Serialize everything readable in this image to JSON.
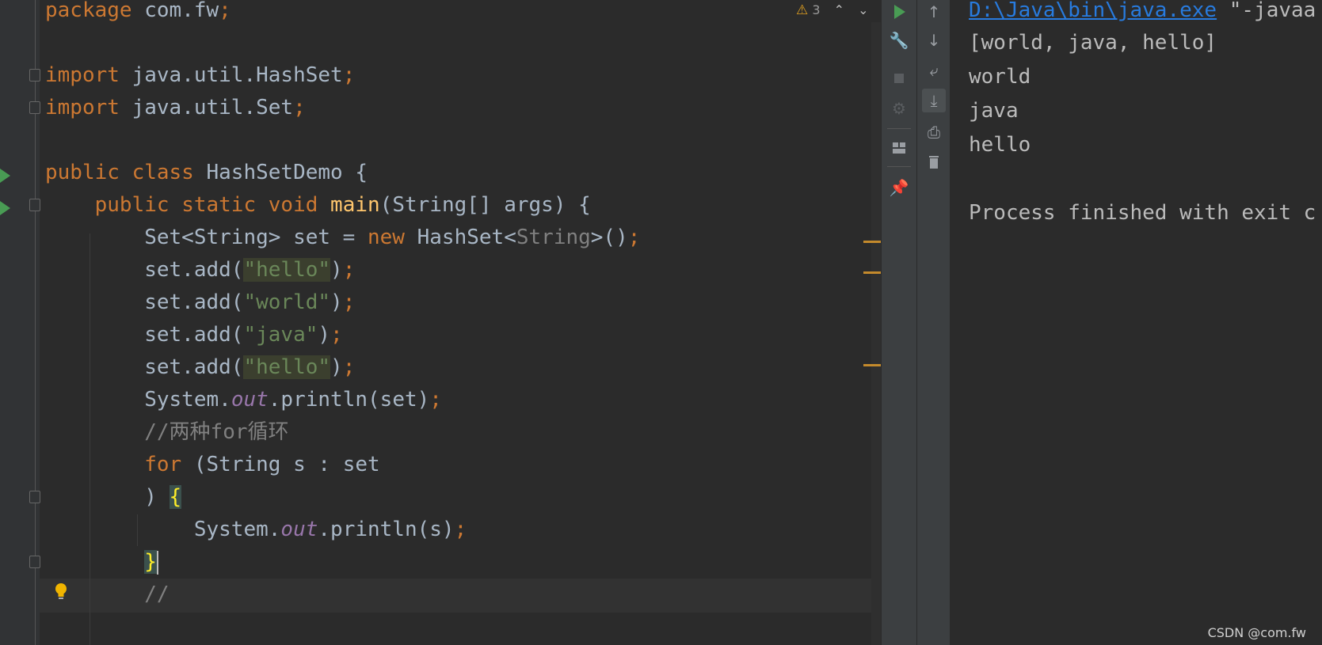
{
  "editor": {
    "lines": [
      {
        "tokens": [
          {
            "t": "package",
            "c": "kw"
          },
          {
            "t": " com.fw"
          },
          {
            "t": ";",
            "c": "kw"
          }
        ]
      },
      {
        "tokens": []
      },
      {
        "tokens": [
          {
            "t": "import",
            "c": "kw"
          },
          {
            "t": " java.util.HashSet"
          },
          {
            "t": ";",
            "c": "kw"
          }
        ]
      },
      {
        "tokens": [
          {
            "t": "import",
            "c": "kw"
          },
          {
            "t": " java.util.Set"
          },
          {
            "t": ";",
            "c": "kw"
          }
        ]
      },
      {
        "tokens": []
      },
      {
        "tokens": [
          {
            "t": "public class",
            "c": "kw"
          },
          {
            "t": " HashSetDemo {"
          }
        ]
      },
      {
        "tokens": [
          {
            "t": "    "
          },
          {
            "t": "public static void",
            "c": "kw"
          },
          {
            "t": " "
          },
          {
            "t": "main",
            "c": "fn"
          },
          {
            "t": "(String[] args) {"
          }
        ]
      },
      {
        "tokens": [
          {
            "t": "        Set<String> set = "
          },
          {
            "t": "new",
            "c": "kw"
          },
          {
            "t": " HashSet<"
          },
          {
            "t": "String",
            "c": "gen"
          },
          {
            "t": ">()"
          },
          {
            "t": ";",
            "c": "kw"
          }
        ]
      },
      {
        "tokens": [
          {
            "t": "        set.add("
          },
          {
            "t": "\"hello\"",
            "c": "str dup"
          },
          {
            "t": ")"
          },
          {
            "t": ";",
            "c": "kw"
          }
        ]
      },
      {
        "tokens": [
          {
            "t": "        set.add("
          },
          {
            "t": "\"world\"",
            "c": "str"
          },
          {
            "t": ")"
          },
          {
            "t": ";",
            "c": "kw"
          }
        ]
      },
      {
        "tokens": [
          {
            "t": "        set.add("
          },
          {
            "t": "\"java\"",
            "c": "str"
          },
          {
            "t": ")"
          },
          {
            "t": ";",
            "c": "kw"
          }
        ]
      },
      {
        "tokens": [
          {
            "t": "        set.add("
          },
          {
            "t": "\"hello\"",
            "c": "str dup"
          },
          {
            "t": ")"
          },
          {
            "t": ";",
            "c": "kw"
          }
        ]
      },
      {
        "tokens": [
          {
            "t": "        System."
          },
          {
            "t": "out",
            "c": "fld"
          },
          {
            "t": ".println(set)"
          },
          {
            "t": ";",
            "c": "kw"
          }
        ]
      },
      {
        "tokens": [
          {
            "t": "        "
          },
          {
            "t": "//两种for循环",
            "c": "cmt"
          }
        ]
      },
      {
        "tokens": [
          {
            "t": "        "
          },
          {
            "t": "for",
            "c": "kw"
          },
          {
            "t": " (String s : set"
          }
        ]
      },
      {
        "tokens": [
          {
            "t": "        ) "
          },
          {
            "t": "{",
            "c": "yel brace-hl"
          }
        ]
      },
      {
        "tokens": [
          {
            "t": "            System."
          },
          {
            "t": "out",
            "c": "fld"
          },
          {
            "t": ".println(s)"
          },
          {
            "t": ";",
            "c": "kw"
          }
        ]
      },
      {
        "tokens": [
          {
            "t": "        "
          },
          {
            "t": "}",
            "c": "yel brace-hl"
          },
          {
            "t": "",
            "c": "caret"
          }
        ]
      },
      {
        "tokens": [
          {
            "t": "        "
          },
          {
            "t": "//",
            "c": "cmt"
          }
        ]
      }
    ],
    "inspection": {
      "warning_count": "3"
    }
  },
  "console": {
    "command_link": "D:\\Java\\bin\\java.exe",
    "command_rest": " \"-javaa",
    "output": [
      "[world, java, hello]",
      "world",
      "java",
      "hello",
      "",
      "Process finished with exit c"
    ]
  },
  "watermark": "CSDN @com.fw",
  "colors": {
    "keyword": "#cc7832",
    "string": "#6a8759",
    "method": "#ffc66d",
    "field": "#9876aa",
    "comment": "#808080",
    "text": "#a9b7c6",
    "run": "#499c54",
    "link": "#287bde"
  }
}
